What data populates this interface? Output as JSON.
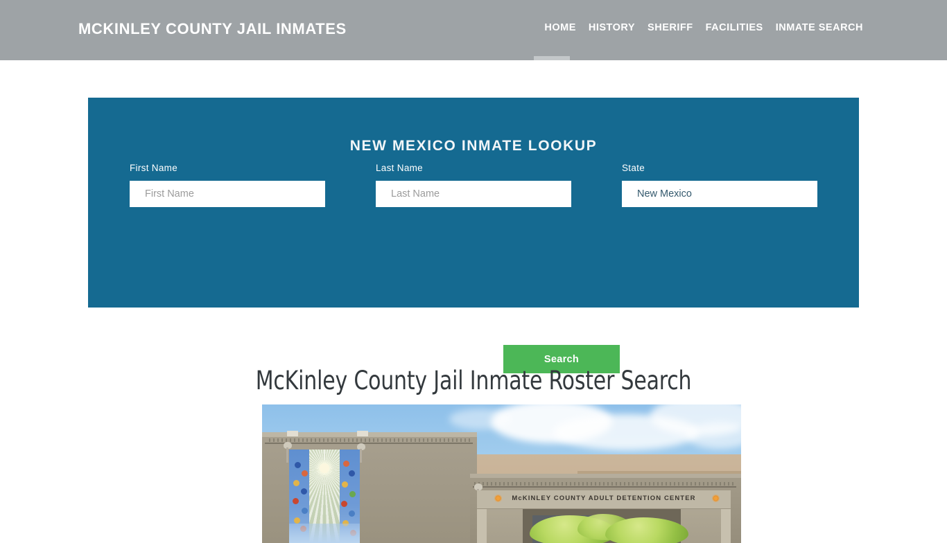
{
  "header": {
    "brand": "MCKINLEY COUNTY JAIL INMATES",
    "nav": [
      {
        "label": "HOME",
        "active": true
      },
      {
        "label": "HISTORY",
        "active": false
      },
      {
        "label": "SHERIFF",
        "active": false
      },
      {
        "label": "FACILITIES",
        "active": false
      },
      {
        "label": "INMATE SEARCH",
        "active": false
      }
    ],
    "background_color": "#9ea3a6",
    "text_color": "#ffffff",
    "active_indicator_color": "#c3c7c9"
  },
  "lookup_panel": {
    "title": "NEW MEXICO INMATE LOOKUP",
    "background_color": "#156a91",
    "fields": [
      {
        "label": "First Name",
        "placeholder": "First Name",
        "value": ""
      },
      {
        "label": "Last Name",
        "placeholder": "Last Name",
        "value": ""
      },
      {
        "label": "State",
        "placeholder": "State",
        "value": "New Mexico"
      }
    ],
    "submit": {
      "label": "Search",
      "background_color": "#4cb757",
      "text_color": "#ffffff"
    }
  },
  "main": {
    "heading": "McKinley County Jail Inmate Roster Search",
    "heading_color": "#33393d",
    "photo": {
      "alt": "McKinley County Adult Detention Center exterior",
      "sign_text": "McKINLEY COUNTY ADULT DETENTION CENTER",
      "sign_emblem_color": "#f0a03c"
    }
  }
}
